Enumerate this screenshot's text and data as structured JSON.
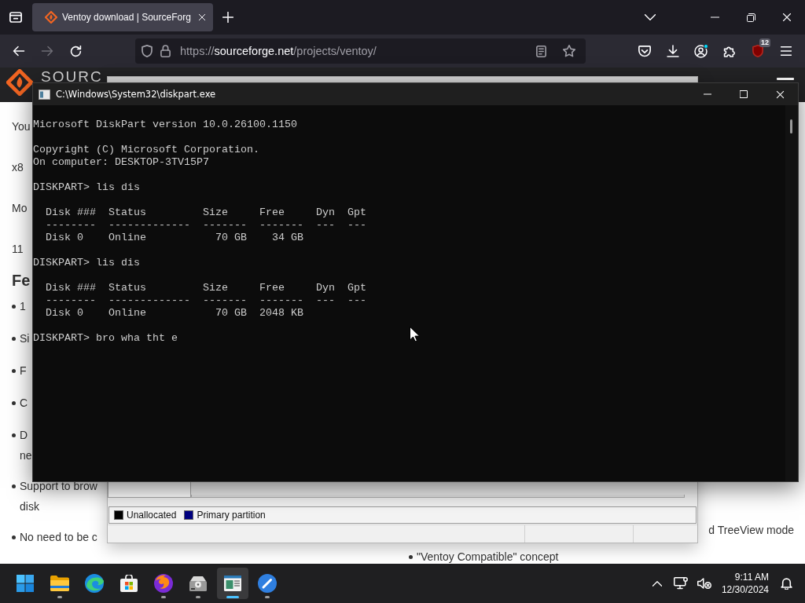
{
  "browser": {
    "tab": {
      "title": "Ventoy download | SourceForg",
      "selected": true
    },
    "nav_buttons": [
      {
        "kind": "back",
        "disabled": false
      },
      {
        "kind": "forward",
        "disabled": true
      },
      {
        "kind": "reload",
        "disabled": false
      }
    ],
    "url": {
      "scheme": "https://",
      "host": "sourceforge.net",
      "path": "/projects/ventoy/"
    },
    "extension_badge": "12"
  },
  "page": {
    "logo_text": "SOURC",
    "left_column": [
      {
        "kind": "paragraph",
        "lines": [
          "You"
        ]
      },
      {
        "kind": "paragraph",
        "lines": [
          "x8"
        ]
      },
      {
        "kind": "paragraph",
        "lines": [
          "Mo"
        ]
      },
      {
        "kind": "paragraph",
        "lines": [
          "11"
        ]
      },
      {
        "kind": "heading",
        "lines": [
          "Fe"
        ]
      },
      {
        "kind": "bullet",
        "lines": [
          "1"
        ]
      },
      {
        "kind": "bullet",
        "lines": [
          "Si"
        ]
      },
      {
        "kind": "bullet",
        "lines": [
          "F"
        ]
      },
      {
        "kind": "bullet",
        "lines": [
          "C"
        ]
      },
      {
        "kind": "bullet",
        "lines": [
          "D",
          "ne"
        ]
      },
      {
        "kind": "bullet",
        "lines": [
          "Support to brow",
          "disk"
        ]
      },
      {
        "kind": "bullet",
        "lines": [
          "No need to be c"
        ]
      }
    ],
    "right_column": [
      {
        "kind": "continuation",
        "lines": [
          "d TreeView mode"
        ]
      },
      {
        "kind": "bullet",
        "lines": [
          "\"Ventoy Compatible\" concept"
        ]
      }
    ]
  },
  "disk_management": {
    "legend": [
      {
        "label": "Unallocated",
        "color": "#000000"
      },
      {
        "label": "Primary partition",
        "color": "#000080"
      }
    ]
  },
  "console_window": {
    "title": "C:\\Windows\\System32\\diskpart.exe",
    "blocks": [
      [
        "Microsoft DiskPart version 10.0.26100.1150"
      ],
      [
        "Copyright (C) Microsoft Corporation.",
        "On computer: DESKTOP-3TV15P7"
      ],
      [
        "DISKPART> lis dis"
      ],
      [
        "  Disk ###  Status         Size     Free     Dyn  Gpt",
        "  --------  -------------  -------  -------  ---  ---",
        "  Disk 0    Online           70 GB    34 GB"
      ],
      [
        "DISKPART> lis dis"
      ],
      [
        "  Disk ###  Status         Size     Free     Dyn  Gpt",
        "  --------  -------------  -------  -------  ---  ---",
        "  Disk 0    Online           70 GB  2048 KB"
      ],
      [
        "DISKPART> bro wha tht e"
      ]
    ]
  },
  "taskbar": {
    "apps": [
      {
        "kind": "start",
        "running": false,
        "selected": false
      },
      {
        "kind": "folder",
        "running": true,
        "selected": false
      },
      {
        "kind": "swirl",
        "running": false,
        "selected": false
      },
      {
        "kind": "store",
        "running": false,
        "selected": false
      },
      {
        "kind": "globe",
        "running": true,
        "selected": false
      },
      {
        "kind": "drive",
        "running": true,
        "selected": false
      },
      {
        "kind": "window",
        "running": true,
        "selected": true
      },
      {
        "kind": "pen",
        "running": true,
        "selected": false
      }
    ],
    "clock": {
      "time": "9:11 AM",
      "date": "12/30/2024"
    }
  }
}
